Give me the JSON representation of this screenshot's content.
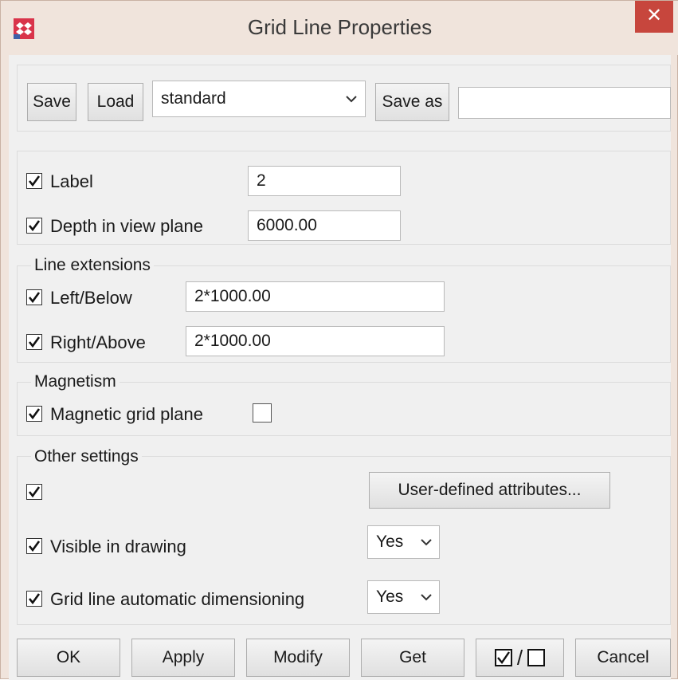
{
  "window": {
    "title": "Grid Line Properties",
    "close_glyph": "✕"
  },
  "toolbar": {
    "save_label": "Save",
    "load_label": "Load",
    "preset_value": "standard",
    "save_as_label": "Save as",
    "save_as_value": ""
  },
  "general": {
    "label_text": "Label",
    "label_value": "2",
    "label_checked": true,
    "depth_text": "Depth in view plane",
    "depth_value": "6000.00",
    "depth_checked": true
  },
  "line_extensions": {
    "title": "Line extensions",
    "left_text": "Left/Below",
    "left_value": "2*1000.00",
    "left_checked": true,
    "right_text": "Right/Above",
    "right_value": "2*1000.00",
    "right_checked": true
  },
  "magnetism": {
    "title": "Magnetism",
    "magnetic_text": "Magnetic grid plane",
    "magnetic_checked": true,
    "magnetic_box_checked": false
  },
  "other_settings": {
    "title": "Other settings",
    "udf_checked": true,
    "udf_button_label": "User-defined attributes...",
    "visible_text": "Visible in drawing",
    "visible_checked": true,
    "visible_value": "Yes",
    "autodim_text": "Grid line automatic dimensioning",
    "autodim_checked": true,
    "autodim_value": "Yes"
  },
  "footer": {
    "ok_label": "OK",
    "apply_label": "Apply",
    "modify_label": "Modify",
    "get_label": "Get",
    "toggle_label": "/",
    "cancel_label": "Cancel"
  },
  "colors": {
    "close_button": "#c7463d",
    "frame": "#f0e4dc",
    "client": "#f0f0f0"
  }
}
